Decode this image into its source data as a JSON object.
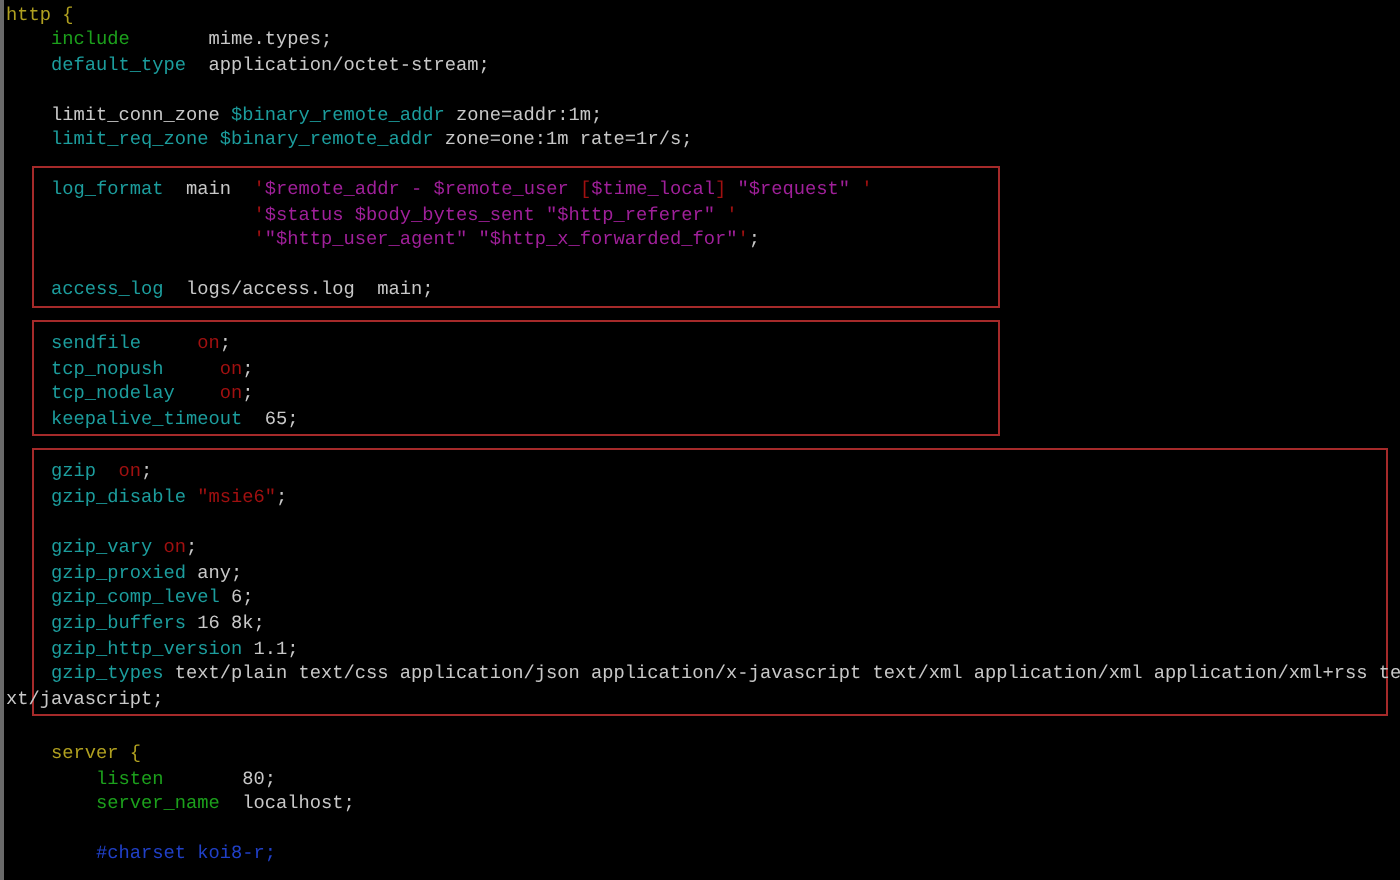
{
  "code": [
    {
      "kind": "code",
      "tokens": [
        {
          "text": "http {",
          "kind": "keyword"
        }
      ],
      "children": [
        {
          "kind": "code",
          "tokens": [
            {
              "text": "include       ",
              "kind": "directive_green"
            },
            {
              "text": "mime.types;",
              "kind": "plain"
            }
          ]
        },
        {
          "kind": "code",
          "tokens": [
            {
              "text": "default_type  ",
              "kind": "directive"
            },
            {
              "text": "application/octet-stream;",
              "kind": "plain"
            }
          ]
        },
        {
          "kind": "blank"
        },
        {
          "kind": "code",
          "tokens": [
            {
              "text": "limit_conn_zone ",
              "kind": "plain"
            },
            {
              "text": "$binary_remote_addr ",
              "kind": "variable"
            },
            {
              "text": "zone=addr:1m;",
              "kind": "plain"
            }
          ]
        },
        {
          "kind": "code",
          "tokens": [
            {
              "text": "limit_req_zone ",
              "kind": "directive"
            },
            {
              "text": "$binary_remote_addr ",
              "kind": "variable"
            },
            {
              "text": "zone=one:1m rate=1r/s;",
              "kind": "plain"
            }
          ]
        },
        {
          "kind": "box",
          "items": [
            {
              "kind": "code",
              "tokens": [
                {
                  "text": "log_format  ",
                  "kind": "directive"
                },
                {
                  "text": "main  ",
                  "kind": "plain"
                },
                {
                  "text": "'",
                  "kind": "red"
                },
                {
                  "text": "$remote_addr - $remote_user ",
                  "kind": "string"
                },
                {
                  "text": "[",
                  "kind": "red"
                },
                {
                  "text": "$time_local",
                  "kind": "string"
                },
                {
                  "text": "] ",
                  "kind": "red"
                },
                {
                  "text": "\"$request\"",
                  "kind": "string"
                },
                {
                  "text": " '",
                  "kind": "red"
                }
              ]
            },
            {
              "kind": "code",
              "tokens": [
                {
                  "text": "                  '",
                  "kind": "red"
                },
                {
                  "text": "$status $body_bytes_sent \"$http_referer\"",
                  "kind": "string"
                },
                {
                  "text": " '",
                  "kind": "red"
                }
              ]
            },
            {
              "kind": "code",
              "tokens": [
                {
                  "text": "                  '",
                  "kind": "red"
                },
                {
                  "text": "\"$http_user_agent\" \"$http_x_forwarded_for\"",
                  "kind": "string"
                },
                {
                  "text": "'",
                  "kind": "red"
                },
                {
                  "text": ";",
                  "kind": "plain"
                }
              ]
            },
            {
              "kind": "blank"
            },
            {
              "kind": "code",
              "tokens": [
                {
                  "text": "access_log  ",
                  "kind": "directive"
                },
                {
                  "text": "logs/access.log  main;",
                  "kind": "plain"
                }
              ]
            }
          ]
        },
        {
          "kind": "box",
          "items": [
            {
              "kind": "code",
              "tokens": [
                {
                  "text": "sendfile     ",
                  "kind": "directive"
                },
                {
                  "text": "on",
                  "kind": "red"
                },
                {
                  "text": ";",
                  "kind": "plain"
                }
              ]
            },
            {
              "kind": "code",
              "tokens": [
                {
                  "text": "tcp_nopush     ",
                  "kind": "directive"
                },
                {
                  "text": "on",
                  "kind": "red"
                },
                {
                  "text": ";",
                  "kind": "plain"
                }
              ]
            },
            {
              "kind": "code",
              "tokens": [
                {
                  "text": "tcp_nodelay    ",
                  "kind": "directive"
                },
                {
                  "text": "on",
                  "kind": "red"
                },
                {
                  "text": ";",
                  "kind": "plain"
                }
              ]
            },
            {
              "kind": "code",
              "tokens": [
                {
                  "text": "keepalive_timeout  ",
                  "kind": "directive"
                },
                {
                  "text": "65;",
                  "kind": "plain"
                }
              ]
            }
          ]
        },
        {
          "kind": "box",
          "items": [
            {
              "kind": "code",
              "tokens": [
                {
                  "text": "gzip  ",
                  "kind": "directive"
                },
                {
                  "text": "on",
                  "kind": "red"
                },
                {
                  "text": ";",
                  "kind": "plain"
                }
              ]
            },
            {
              "kind": "code",
              "tokens": [
                {
                  "text": "gzip_disable ",
                  "kind": "directive"
                },
                {
                  "text": "\"msie6\"",
                  "kind": "red"
                },
                {
                  "text": ";",
                  "kind": "plain"
                }
              ]
            },
            {
              "kind": "blank"
            },
            {
              "kind": "code",
              "tokens": [
                {
                  "text": "gzip_vary ",
                  "kind": "directive"
                },
                {
                  "text": "on",
                  "kind": "red"
                },
                {
                  "text": ";",
                  "kind": "plain"
                }
              ]
            },
            {
              "kind": "code",
              "tokens": [
                {
                  "text": "gzip_proxied ",
                  "kind": "directive"
                },
                {
                  "text": "any;",
                  "kind": "plain"
                }
              ]
            },
            {
              "kind": "code",
              "tokens": [
                {
                  "text": "gzip_comp_level ",
                  "kind": "directive"
                },
                {
                  "text": "6;",
                  "kind": "plain"
                }
              ]
            },
            {
              "kind": "code",
              "tokens": [
                {
                  "text": "gzip_buffers ",
                  "kind": "directive"
                },
                {
                  "text": "16 8k;",
                  "kind": "plain"
                }
              ]
            },
            {
              "kind": "code",
              "tokens": [
                {
                  "text": "gzip_http_version ",
                  "kind": "directive"
                },
                {
                  "text": "1.1;",
                  "kind": "plain"
                }
              ]
            },
            {
              "kind": "code",
              "tokens": [
                {
                  "text": "gzip_types ",
                  "kind": "directive"
                },
                {
                  "text": "text/plain text/css application/json application/x-javascript text/xml application/xml application/xml+rss te",
                  "kind": "plain"
                }
              ]
            },
            {
              "kind": "wrap",
              "tokens": [
                {
                  "text": "xt/javascript;",
                  "kind": "plain"
                }
              ]
            }
          ]
        },
        {
          "kind": "blank"
        },
        {
          "kind": "code",
          "tokens": [
            {
              "text": "server {",
              "kind": "keyword"
            }
          ],
          "children": [
            {
              "kind": "code",
              "tokens": [
                {
                  "text": "listen       ",
                  "kind": "directive_green"
                },
                {
                  "text": "80;",
                  "kind": "plain"
                }
              ]
            },
            {
              "kind": "code",
              "tokens": [
                {
                  "text": "server_name  ",
                  "kind": "directive_green"
                },
                {
                  "text": "localhost;",
                  "kind": "plain"
                }
              ]
            },
            {
              "kind": "blank"
            },
            {
              "kind": "code",
              "tokens": [
                {
                  "text": "#charset koi8-r;",
                  "kind": "comment"
                }
              ]
            }
          ]
        }
      ]
    }
  ]
}
